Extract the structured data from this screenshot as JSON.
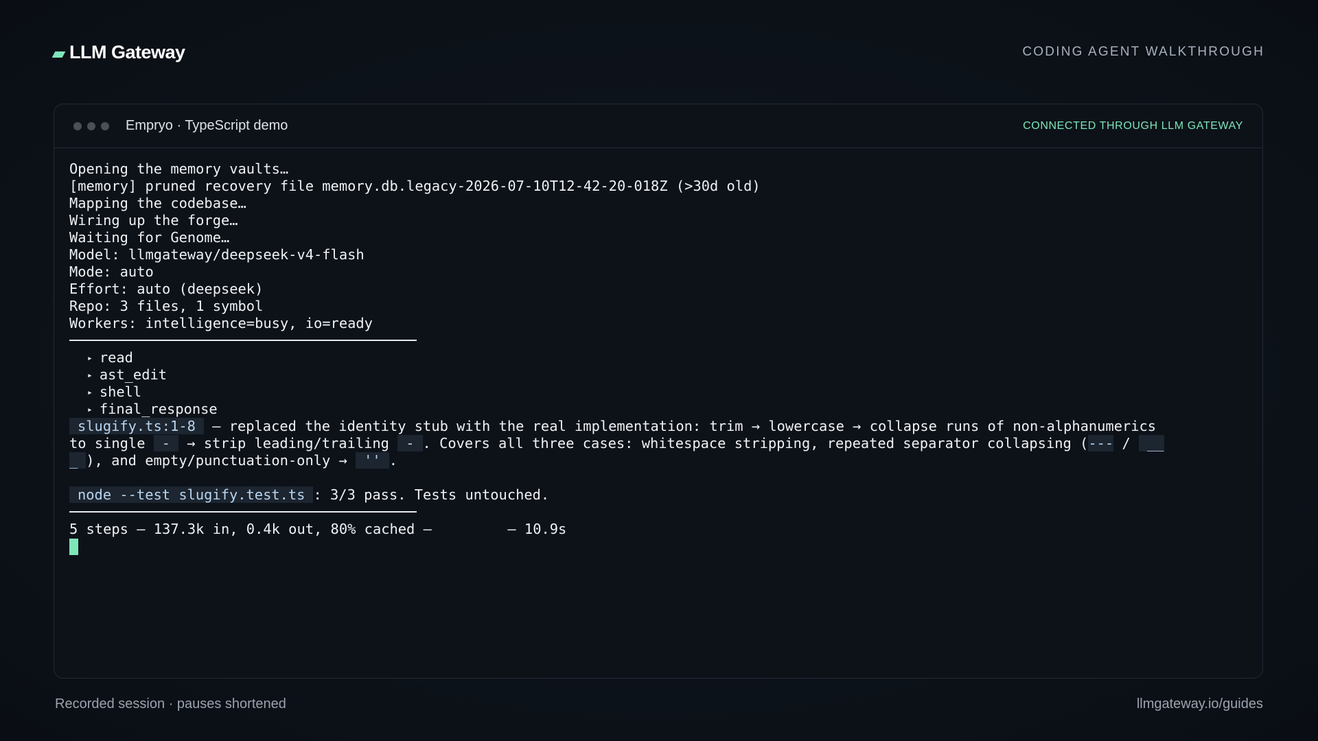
{
  "header": {
    "brand": "LLM Gateway",
    "tag": "CODING AGENT WALKTHROUGH"
  },
  "window": {
    "title": "Empryo · TypeScript demo",
    "status": "CONNECTED THROUGH LLM GATEWAY"
  },
  "terminal": {
    "startup_lines": [
      "Opening the memory vaults…",
      "[memory] pruned recovery file memory.db.legacy-2026-07-10T12-42-20-018Z (>30d old)",
      "Mapping the codebase…",
      "Wiring up the forge…",
      "Waiting for Genome…",
      "Model: llmgateway/deepseek-v4-flash",
      "Mode: auto",
      "Effort: auto (deepseek)",
      "Repo: 3 files, 1 symbol",
      "Workers: intelligence=busy, io=ready"
    ],
    "tools": [
      "read",
      "ast_edit",
      "shell",
      "final_response"
    ],
    "tool_marker": "▸",
    "summary": {
      "file_ref": "slugify.ts:1-8",
      "text1": " — replaced the identity stub with the real implementation: trim → lowercase → collapse runs of non-alphanumerics to single ",
      "dash_code": "-",
      "text2": " → strip leading/trailing ",
      "dash_code2": "-",
      "text3": ". Covers all three cases: whitespace stripping, repeated separator collapsing (",
      "triple_dash": "---",
      "slash": " / ",
      "triple_underscore": "___",
      "text4": "), and empty/punctuation-only → ",
      "empty_quotes": "''",
      "text5": "."
    },
    "test": {
      "command": "node --test slugify.test.ts",
      "result": ": 3/3 pass. Tests untouched."
    },
    "stats": "5 steps — 137.3k in, 0.4k out, 80% cached —         — 10.9s"
  },
  "footer": {
    "left": "Recorded session · pauses shortened",
    "right": "llmgateway.io/guides"
  },
  "colors": {
    "accent": "#7ee6b8",
    "background": "#0d1117",
    "code_bg": "#1c2530"
  }
}
